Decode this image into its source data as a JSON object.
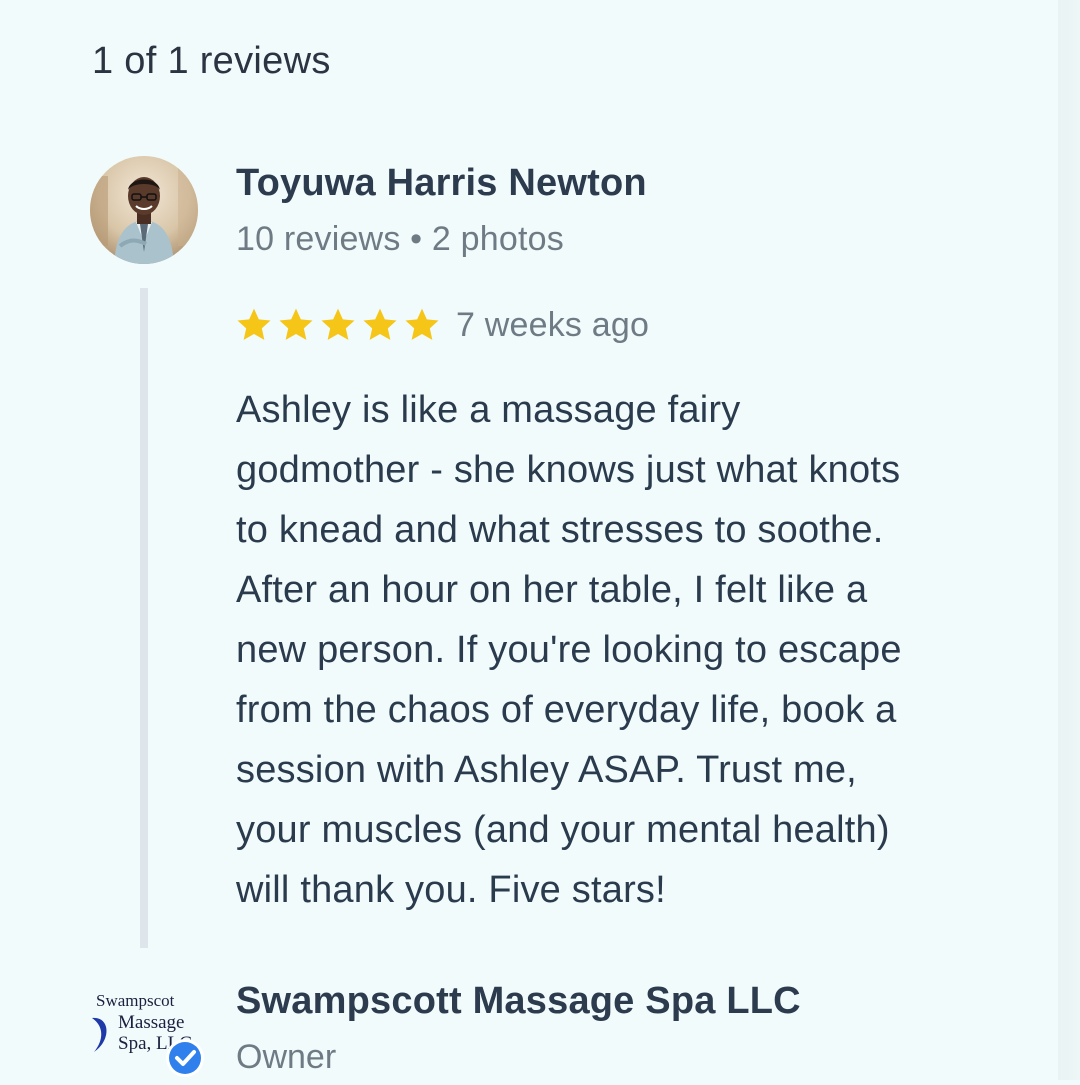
{
  "header": {
    "count_text": "1 of 1 reviews"
  },
  "review": {
    "reviewer": {
      "name": "Toyuwa Harris Newton",
      "meta": "10 reviews • 2 photos",
      "avatar_icon": "person-photo"
    },
    "rating": {
      "stars": 5,
      "max": 5,
      "star_color": "#f5c518"
    },
    "time_ago": "7 weeks ago",
    "text_lines": [
      "Ashley is like a massage fairy",
      "godmother - she knows just what knots",
      "to knead and what stresses to soothe.",
      "After an hour on her table, I felt like a",
      "new person. If you're looking to escape",
      "from the chaos of everyday life, book a",
      "session with Ashley ASAP. Trust me,",
      "your muscles (and your mental health)",
      "will thank you. Five stars!"
    ]
  },
  "owner": {
    "name": "Swampscott Massage Spa LLC",
    "role": "Owner",
    "logo_lines": [
      "Swampscot",
      "Massage",
      "Spa, LLC"
    ],
    "verified_icon": "verified-check",
    "verified_color": "#2f80ed"
  },
  "colors": {
    "background": "#f2fbfb",
    "text_primary": "#2d3b4f",
    "text_secondary": "#6e7b85",
    "thread_bar": "#dfe6eb"
  }
}
